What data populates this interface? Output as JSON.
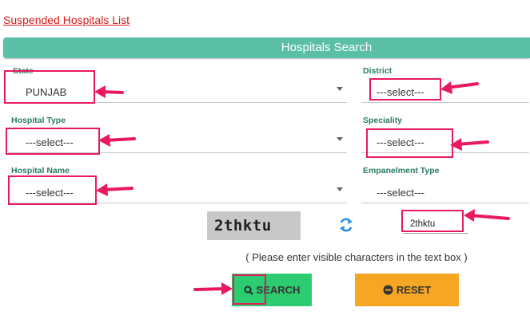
{
  "top_link": "Suspended Hospitals List",
  "header": {
    "title": "Hospitals Search"
  },
  "fields": {
    "state": {
      "label": "State",
      "value": "PUNJAB"
    },
    "district": {
      "label": "District",
      "value": "---select---"
    },
    "hospital_type": {
      "label": "Hospital Type",
      "value": "---select---"
    },
    "speciality": {
      "label": "Speciality",
      "value": "---select---"
    },
    "hospital_name": {
      "label": "Hospital Name",
      "value": "---select---"
    },
    "empanelment_type": {
      "label": "Empanelment Type",
      "value": "---select---"
    }
  },
  "captcha": {
    "image_text": "2thktu",
    "input_value": "2thktu",
    "hint": "( Please enter visible characters in the text box )"
  },
  "buttons": {
    "search": "SEARCH",
    "reset": "RESET"
  },
  "colors": {
    "header": "#5bbfa8",
    "link": "#d71a1a",
    "label": "#2a7a66",
    "annotation": "#e8195f",
    "search_button": "#2ecc71",
    "reset_button": "#f5a623"
  },
  "icons": {
    "refresh": "refresh-icon",
    "search": "search-icon",
    "reset": "minus-circle-icon",
    "dropdown": "caret-down-icon"
  }
}
